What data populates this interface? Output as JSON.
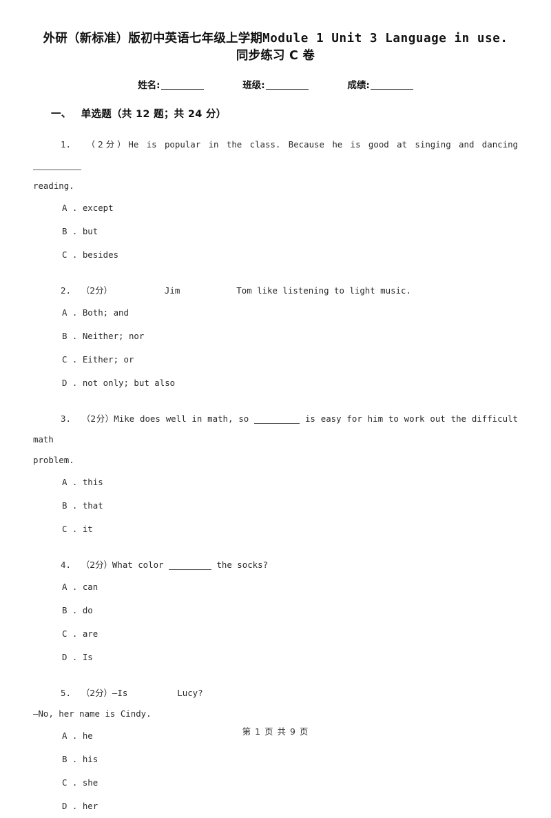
{
  "title": {
    "line1_cjk_a": "外研（新标准）版初中英语七年级上学期",
    "line1_latin": "Module 1 Unit 3 Language in use.",
    "line2": "同步练习 C 卷"
  },
  "identity": {
    "name_label": "姓名:",
    "class_label": "班级:",
    "score_label": "成绩:"
  },
  "section": {
    "number": "一、",
    "label": "单选题（共 12 题；共 24 分）"
  },
  "questions": [
    {
      "number": "1.",
      "score": "（2分）",
      "stem": "He is popular in the class. Because he is good at singing and dancing",
      "continuation": "reading.",
      "options": [
        "A . except",
        "B . but",
        "C . besides"
      ]
    },
    {
      "number": "2.",
      "score": "（2分）",
      "stem_part1": "Jim",
      "stem_part2": "Tom like listening to light music.",
      "options": [
        "A . Both; and",
        "B . Neither; nor",
        "C . Either; or",
        "D . not only; but also"
      ]
    },
    {
      "number": "3.",
      "score": "（2分）",
      "stem_part1": "Mike does well in math, so",
      "stem_part2": "is easy for him to work out the difficult math",
      "continuation": "problem.",
      "options": [
        "A . this",
        "B . that",
        "C . it"
      ]
    },
    {
      "number": "4.",
      "score": "（2分）",
      "stem_part1": "What color",
      "stem_part2": "the socks?",
      "options": [
        "A . can",
        "B . do",
        "C . are",
        "D . Is"
      ]
    },
    {
      "number": "5.",
      "score": "（2分）",
      "stem_part1": "—Is",
      "stem_part2": "Lucy?",
      "continuation": "—No, her name is Cindy.",
      "options": [
        "A . he",
        "B . his",
        "C . she",
        "D . her"
      ]
    }
  ],
  "footer": {
    "text": "第 1 页 共 9 页"
  }
}
